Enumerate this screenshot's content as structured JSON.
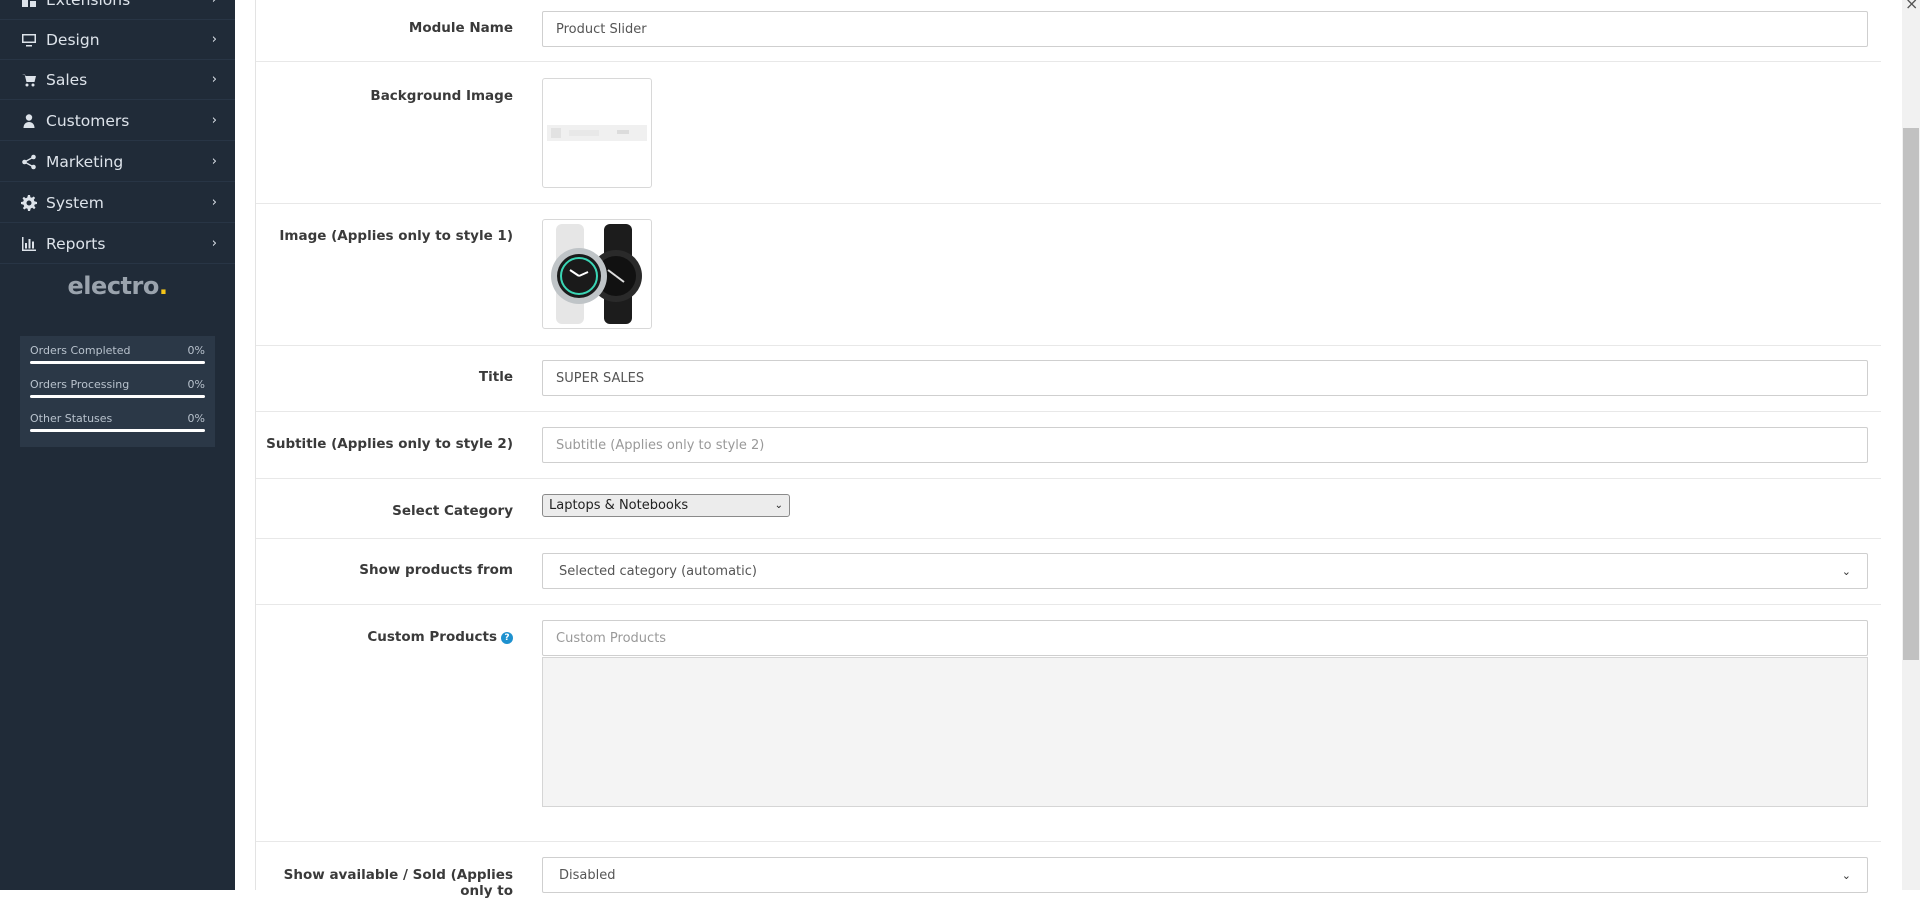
{
  "sidebar": {
    "items": [
      {
        "label": "Extensions",
        "icon": "puzzle-icon"
      },
      {
        "label": "Design",
        "icon": "monitor-icon"
      },
      {
        "label": "Sales",
        "icon": "cart-icon"
      },
      {
        "label": "Customers",
        "icon": "user-icon"
      },
      {
        "label": "Marketing",
        "icon": "share-icon"
      },
      {
        "label": "System",
        "icon": "gear-icon"
      },
      {
        "label": "Reports",
        "icon": "bar-chart-icon"
      }
    ],
    "chevron": "›",
    "logo": {
      "text": "electro",
      "dot": "."
    },
    "statuses": [
      {
        "label": "Orders Completed",
        "value": "0%",
        "progress": 0
      },
      {
        "label": "Orders Processing",
        "value": "0%",
        "progress": 0
      },
      {
        "label": "Other Statuses",
        "value": "0%",
        "progress": 0
      }
    ]
  },
  "form": {
    "module_name": {
      "label": "Module Name",
      "value": "Product Slider"
    },
    "background_image": {
      "label": "Background Image"
    },
    "image": {
      "label": "Image (Applies only to style 1)"
    },
    "title": {
      "label": "Title",
      "value": "SUPER SALES"
    },
    "subtitle": {
      "label": "Subtitle (Applies only to style 2)",
      "placeholder": "Subtitle (Applies only to style 2)"
    },
    "select_category": {
      "label": "Select Category",
      "value": "Laptops & Notebooks"
    },
    "show_products_from": {
      "label": "Show products from",
      "value": "Selected category (automatic)"
    },
    "custom_products": {
      "label": "Custom Products",
      "placeholder": "Custom Products",
      "help": "?"
    },
    "show_available": {
      "label": "Show available / Sold (Applies only to",
      "value": "Disabled"
    }
  },
  "window": {
    "close": "×"
  },
  "colors": {
    "sidebar_bg": "#202b38",
    "accent": "#1e91cf",
    "logo_dot": "#f5c518"
  }
}
